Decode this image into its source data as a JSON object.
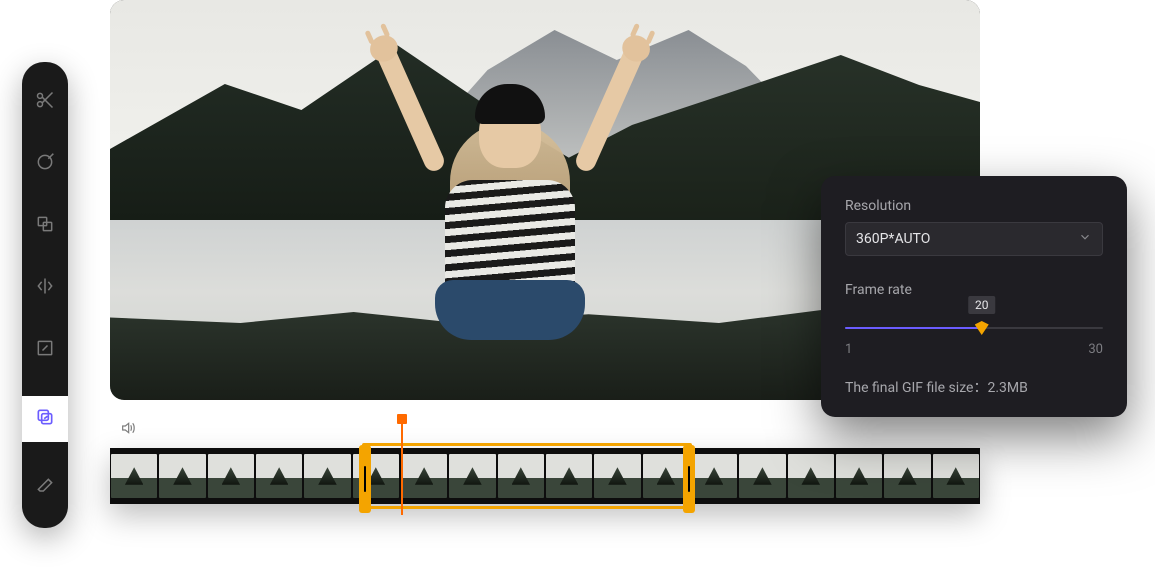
{
  "sidebar": {
    "tools": [
      {
        "name": "cut"
      },
      {
        "name": "adjust"
      },
      {
        "name": "crop"
      },
      {
        "name": "mirror"
      },
      {
        "name": "resize"
      },
      {
        "name": "export-gif",
        "active": true
      },
      {
        "name": "erase"
      }
    ]
  },
  "panel": {
    "resolution_label": "Resolution",
    "resolution_value": "360P*AUTO",
    "frame_rate_label": "Frame rate",
    "frame_rate_value": "20",
    "frame_rate_min": "1",
    "frame_rate_max": "30",
    "final_size_text": "The final GIF file size：2.3MB"
  },
  "timeline": {
    "thumb_count": 18
  },
  "slider_percent": 53
}
